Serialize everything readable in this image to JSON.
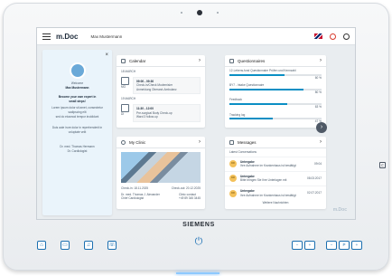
{
  "topbar": {
    "logo_text": "m.Doc",
    "username": "Max Mustermann"
  },
  "welcome": {
    "close": "×",
    "greeting": "Welcome",
    "name": "Max Mustermann",
    "title_1": "Become your own expert in",
    "title_2": "small steps!",
    "text_1": "Lorem ipsum dolor sit amet, consectetur sadipscing elit",
    "text_2": "sed do eiusmod tempor incididunt",
    "text_3": "Duis aute irure dolor in reprehenderit in voluptate velit",
    "signature_1": "Dr. med. Thomas Hermann",
    "signature_2": "Dr. Cardiologist"
  },
  "calendar": {
    "title": "Calendar",
    "today_label": "18 MARCH",
    "event_1_day": "MO",
    "event_1_time": "09:00 - 09:30",
    "event_1_name": "Check-in/Check Modernisier",
    "event_1_note": "Anmeldung Oberarzt-Ambulanz",
    "tomorrow_label": "19 MARCH",
    "event_2_day": "DI",
    "event_2_time": "11:30 - 12:00",
    "event_2_name": "Pre-surgical Body Check-up",
    "event_2_note": "Ward 3 follow-up"
  },
  "questionnaires": {
    "title": "Questionnaires",
    "items": [
      {
        "label": "12-Lebens-fund Questionnaire Prüfen und Kennzahl",
        "percent": "60 %"
      },
      {
        "label": "BY7 - Intake Questionnaire",
        "percent": "80 %"
      },
      {
        "label": "Feedback",
        "percent": "63 %"
      },
      {
        "label": "Tracking log",
        "percent": "47 %"
      }
    ]
  },
  "clinic": {
    "title": "My Clinic",
    "check_in": "Check-in: 18.11.2025",
    "check_out": "Check-out: 20.12.2025",
    "doctor": "Dr. med. Thomas J. Alexander",
    "doctor_role": "Chief Cardiologist",
    "contact_label": "Clinic contact",
    "phone": "+49 89 345 3445"
  },
  "messages": {
    "title": "Messages",
    "section_label": "Latest Conversations",
    "items": [
      {
        "badge": "DR",
        "title": "Untergabe",
        "text": "Ihre Aufnahme im Krankenhaus ist bestätigt",
        "date": "09:04"
      },
      {
        "badge": "DR",
        "title": "Untergabe",
        "text": "Bitte bringen Sie Ihre Unterlagen mit",
        "date": "08.03.2017"
      },
      {
        "badge": "DR",
        "title": "Untergabe",
        "text": "Ihre Aufnahme im Krankenhaus ist bestätigt",
        "date": "02.07.2017"
      }
    ],
    "more_label": "Weitere Nachrichten"
  },
  "device": {
    "brand": "SIEMENS",
    "watermark": "m.Doc"
  },
  "hardware": {
    "home": "⌂",
    "screen": "▭",
    "media": "♫",
    "phone": "☏",
    "vol_minus": "−",
    "vol_plus": "+",
    "p_minus": "−",
    "p_plus": "+",
    "p_label": "P",
    "side": "⊏"
  }
}
